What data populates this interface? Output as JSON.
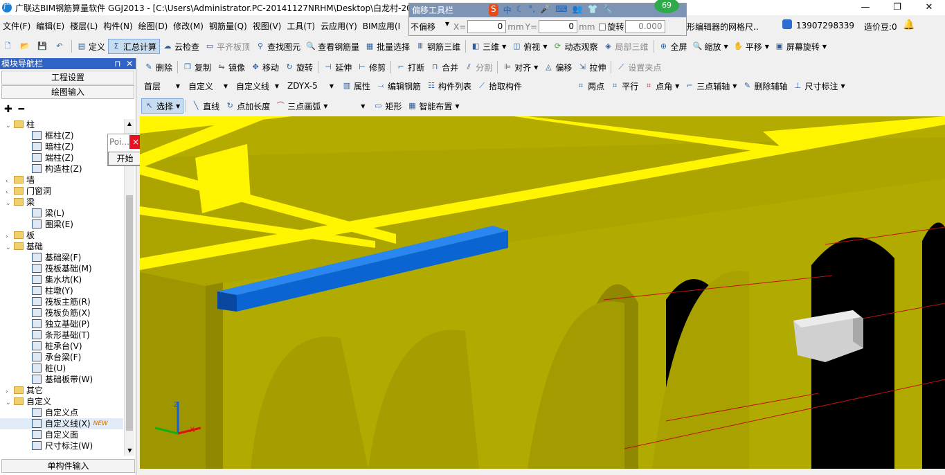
{
  "window": {
    "title": "广联达BIM钢筋算量软件 GGJ2013 - [C:\\Users\\Administrator.PC-20141127NRHM\\Desktop\\白龙村-20",
    "min": "—",
    "max": "❐",
    "close": "✕"
  },
  "menu": [
    "文件(F)",
    "编辑(E)",
    "楼层(L)",
    "构件(N)",
    "绘图(D)",
    "修改(M)",
    "钢筋量(Q)",
    "视图(V)",
    "工具(T)",
    "云应用(Y)",
    "BIM应用(I"
  ],
  "menu_right": {
    "hint": "形编辑器的网格尺..",
    "phone": "13907298339",
    "beans": "造价豆:0"
  },
  "float_toolbar": {
    "title": "偏移工具栏",
    "mode": "不偏移",
    "x_label": "X=",
    "x_value": "0",
    "x_unit": "mm",
    "y_label": "Y=",
    "y_value": "0",
    "y_unit": "mm",
    "rotate_label": "旋转",
    "rotate_value": "0.000",
    "badge": "69"
  },
  "toolbar1": [
    "定义",
    "汇总计算",
    "云检查",
    "平齐板顶",
    "查找图元",
    "查看钢筋量",
    "批量选择",
    "钢筋三维",
    "三维",
    "俯视",
    "动态观察",
    "局部三维",
    "全屏",
    "缩放",
    "平移",
    "屏幕旋转"
  ],
  "toolbar2": [
    "删除",
    "复制",
    "镜像",
    "移动",
    "旋转",
    "延伸",
    "修剪",
    "打断",
    "合并",
    "分割",
    "对齐",
    "偏移",
    "拉伸",
    "设置夹点"
  ],
  "toolbar3": {
    "floor": "首层",
    "category": "自定义",
    "type": "自定义线",
    "name": "ZDYX-5",
    "actions": [
      "属性",
      "编辑钢筋",
      "构件列表",
      "拾取构件"
    ],
    "axis": [
      "两点",
      "平行",
      "点角",
      "三点辅轴",
      "删除辅轴",
      "尺寸标注"
    ]
  },
  "toolbar4": [
    "选择",
    "直线",
    "点加长度",
    "三点画弧",
    "矩形",
    "智能布置"
  ],
  "panel": {
    "title": "模块导航栏",
    "pin": "⊓",
    "close": "✕",
    "btn1": "工程设置",
    "btn2": "绘图输入",
    "bottom": "单构件输入"
  },
  "tree": [
    {
      "t": "柱",
      "lvl": 0,
      "folder": true,
      "open": true
    },
    {
      "t": "框柱(Z)",
      "lvl": 1
    },
    {
      "t": "暗柱(Z)",
      "lvl": 1
    },
    {
      "t": "端柱(Z)",
      "lvl": 1
    },
    {
      "t": "构造柱(Z)",
      "lvl": 1
    },
    {
      "t": "墙",
      "lvl": 0,
      "folder": true,
      "open": false
    },
    {
      "t": "门窗洞",
      "lvl": 0,
      "folder": true,
      "open": false
    },
    {
      "t": "梁",
      "lvl": 0,
      "folder": true,
      "open": true
    },
    {
      "t": "梁(L)",
      "lvl": 1
    },
    {
      "t": "圈梁(E)",
      "lvl": 1
    },
    {
      "t": "板",
      "lvl": 0,
      "folder": true,
      "open": false
    },
    {
      "t": "基础",
      "lvl": 0,
      "folder": true,
      "open": true
    },
    {
      "t": "基础梁(F)",
      "lvl": 1
    },
    {
      "t": "筏板基础(M)",
      "lvl": 1
    },
    {
      "t": "集水坑(K)",
      "lvl": 1
    },
    {
      "t": "柱墩(Y)",
      "lvl": 1
    },
    {
      "t": "筏板主筋(R)",
      "lvl": 1
    },
    {
      "t": "筏板负筋(X)",
      "lvl": 1
    },
    {
      "t": "独立基础(P)",
      "lvl": 1
    },
    {
      "t": "条形基础(T)",
      "lvl": 1
    },
    {
      "t": "桩承台(V)",
      "lvl": 1
    },
    {
      "t": "承台梁(F)",
      "lvl": 1
    },
    {
      "t": "桩(U)",
      "lvl": 1
    },
    {
      "t": "基础板带(W)",
      "lvl": 1
    },
    {
      "t": "其它",
      "lvl": 0,
      "folder": true,
      "open": false
    },
    {
      "t": "自定义",
      "lvl": 0,
      "folder": true,
      "open": true
    },
    {
      "t": "自定义点",
      "lvl": 1
    },
    {
      "t": "自定义线(X)",
      "lvl": 1,
      "selected": true,
      "badge": "NEW"
    },
    {
      "t": "自定义面",
      "lvl": 1
    },
    {
      "t": "尺寸标注(W)",
      "lvl": 1
    }
  ],
  "popup": {
    "title": "Poi...",
    "close": "×",
    "button": "开始"
  },
  "colors": {
    "wall": "#b5ad00",
    "beam": "#fff500",
    "selected": "#0a64d2",
    "title_bar": "#2f63c6"
  }
}
